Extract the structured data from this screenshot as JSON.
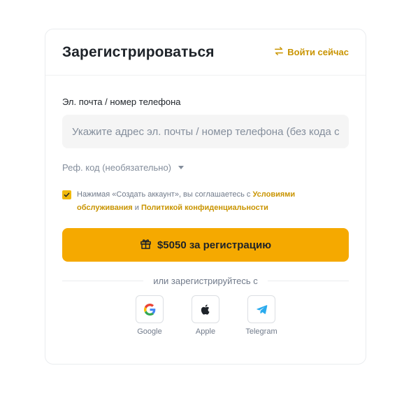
{
  "header": {
    "title": "Зарегистрироваться",
    "login_link": "Войти сейчас"
  },
  "form": {
    "email_label": "Эл. почта / номер телефона",
    "email_placeholder": "Укажите адрес эл. почты / номер телефона (без кода страны)",
    "email_value": "",
    "referral_label": "Реф. код (необязательно)",
    "terms_checked": true,
    "terms_prefix": "Нажимая «Создать аккаунт», вы соглашаетесь с ",
    "terms_link": "Условиями обслуживания",
    "terms_and": " и ",
    "privacy_link": "Политикой конфиденциальности",
    "submit_label": "$5050 за регистрацию"
  },
  "social": {
    "divider_text": "или зарегистрируйтесь с",
    "providers": [
      {
        "label": "Google",
        "icon": "google-icon"
      },
      {
        "label": "Apple",
        "icon": "apple-icon"
      },
      {
        "label": "Telegram",
        "icon": "telegram-icon"
      }
    ]
  },
  "colors": {
    "accent": "#f5a900",
    "link": "#c99400",
    "muted": "#848e9c",
    "telegram": "#2aabee"
  }
}
